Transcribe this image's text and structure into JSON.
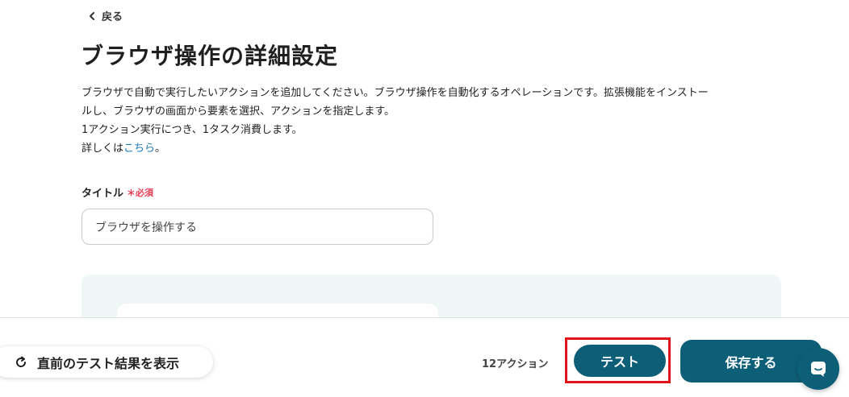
{
  "nav": {
    "back_label": "戻る"
  },
  "page": {
    "title": "ブラウザ操作の詳細設定",
    "description": {
      "line1": "ブラウザで自動で実行したいアクションを追加してください。ブラウザ操作を自動化するオペレーションです。拡張機能をインストー",
      "line2": "ルし、ブラウザの画面から要素を選択、アクションを指定します。",
      "line3": "1アクション実行につき、1タスク消費します。",
      "line4_prefix": "詳しくは",
      "line4_link": "こちら",
      "line4_suffix": "。"
    }
  },
  "form": {
    "title_label": "タイトル",
    "required_mark": "＊必須",
    "title_value": "ブラウザを操作する"
  },
  "footer": {
    "show_prev_label": "直前のテスト結果を表示",
    "action_count": "12アクション",
    "test_label": "テスト",
    "save_label": "保存する"
  },
  "colors": {
    "primary": "#0d5f78",
    "required": "#e53d54",
    "link": "#1a78b8",
    "highlight": "#e3131a",
    "panel_bg": "#eef7f6"
  },
  "icons": {
    "back": "chevron-left-icon",
    "refresh": "refresh-icon",
    "chat": "chat-icon"
  }
}
